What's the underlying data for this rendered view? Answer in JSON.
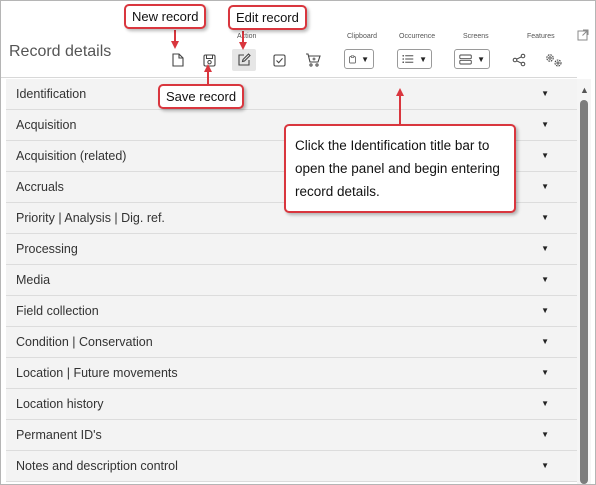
{
  "header": {
    "title": "Record details",
    "groups": {
      "action": "Action",
      "clipboard": "Clipboard",
      "occurrence": "Occurrence",
      "screens": "Screens",
      "features": "Features"
    },
    "icons": [
      "new-record-icon",
      "save-record-icon",
      "edit-record-icon",
      "check-icon",
      "cart-icon",
      "clipboard-icon",
      "list-icon",
      "screens-icon",
      "share-icon",
      "gears-icon"
    ]
  },
  "sections": [
    {
      "label": "Identification"
    },
    {
      "label": "Acquisition"
    },
    {
      "label": "Acquisition (related)"
    },
    {
      "label": "Accruals"
    },
    {
      "label": "Priority | Analysis | Dig. ref."
    },
    {
      "label": "Processing"
    },
    {
      "label": "Media"
    },
    {
      "label": "Field collection"
    },
    {
      "label": "Condition | Conservation"
    },
    {
      "label": "Location | Future movements"
    },
    {
      "label": "Location history"
    },
    {
      "label": "Permanent ID's"
    },
    {
      "label": "Notes and description control"
    }
  ],
  "callouts": {
    "new_record": "New record",
    "edit_record": "Edit record",
    "save_record": "Save record",
    "identification_tip": "Click the Identification title bar to open the panel and begin entering record details."
  },
  "colors": {
    "callout_border": "#d9363e",
    "row_bg": "#f3f3f3",
    "scroll_thumb": "#7d7d7d"
  }
}
